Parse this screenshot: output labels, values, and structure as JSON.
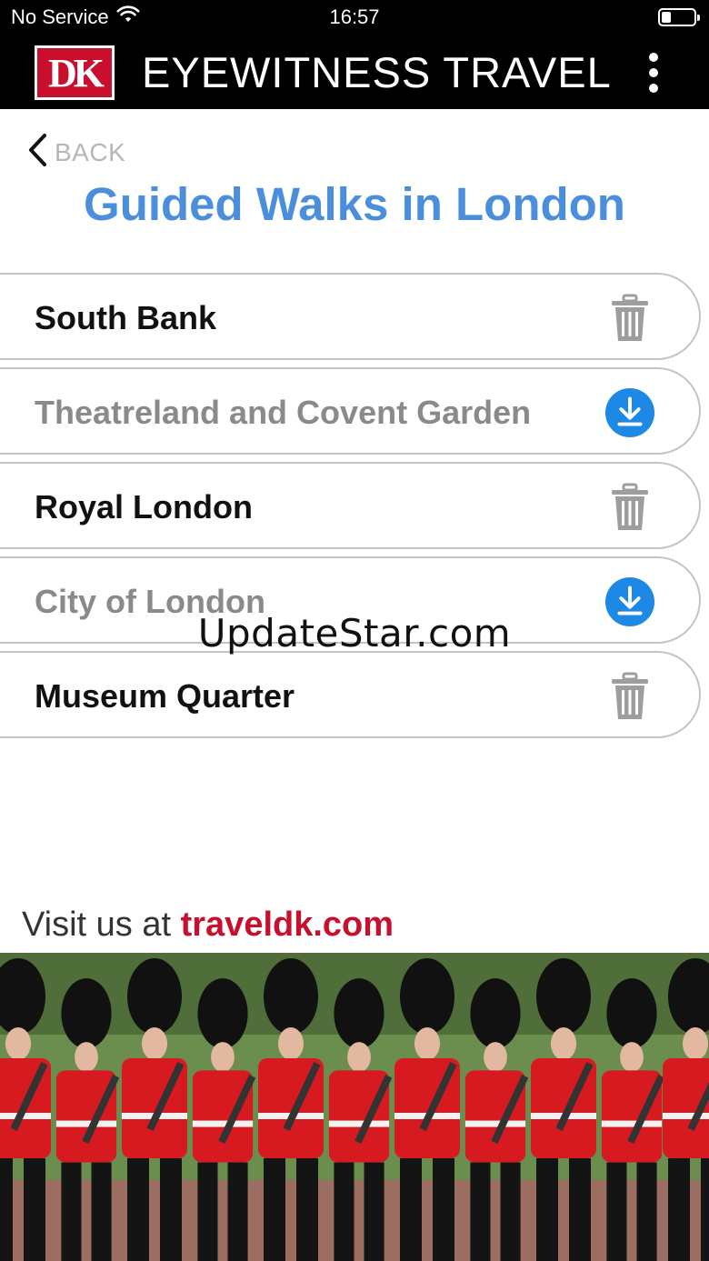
{
  "status_bar": {
    "carrier": "No Service",
    "time": "16:57",
    "battery_level": 0.25
  },
  "header": {
    "logo_text": "DK",
    "title": "EYEWITNESS TRAVEL"
  },
  "nav": {
    "back_label": "BACK"
  },
  "page_title": "Guided Walks in London",
  "walks": [
    {
      "name": "South Bank",
      "downloaded": true,
      "action_icon": "trash-icon"
    },
    {
      "name": "Theatreland and Covent Garden",
      "downloaded": false,
      "action_icon": "download-icon"
    },
    {
      "name": "Royal London",
      "downloaded": true,
      "action_icon": "trash-icon"
    },
    {
      "name": "City of London",
      "downloaded": false,
      "action_icon": "download-icon"
    },
    {
      "name": "Museum Quarter",
      "downloaded": true,
      "action_icon": "trash-icon"
    }
  ],
  "watermark": "UpdateStar.com",
  "footer": {
    "visit_prefix": "Visit us at ",
    "visit_link": "traveldk.com"
  },
  "colors": {
    "header_bg": "#000000",
    "title_blue": "#4b8fdc",
    "download_blue": "#1e88e5",
    "brand_red": "#c8102e",
    "trash_gray": "#9e9e9e"
  }
}
